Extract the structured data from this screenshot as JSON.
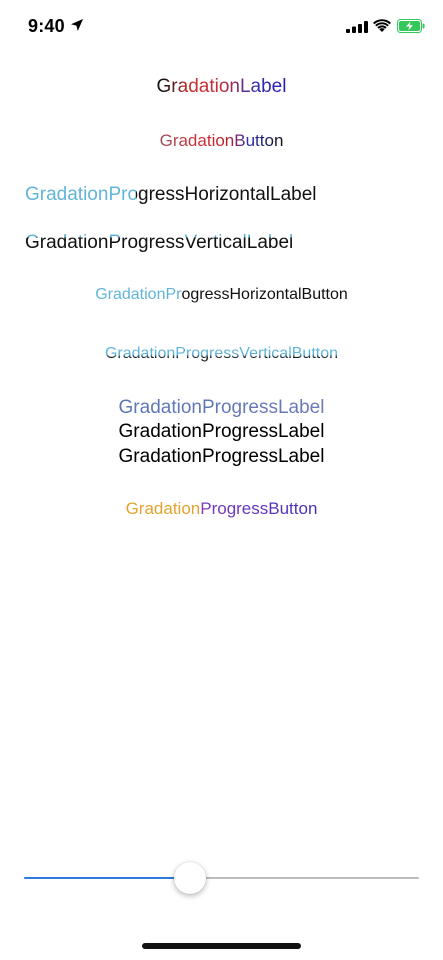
{
  "status_bar": {
    "time": "9:40",
    "icons": [
      "location-arrow-icon",
      "cellular-signal-icon",
      "wifi-icon",
      "battery-charging-icon"
    ],
    "battery_color": "#34c759"
  },
  "labels": {
    "gradation_label": "GradationLabel",
    "gradation_button": "GradationButton",
    "progress_horizontal_label": "GradationProgressHorizontalLabel",
    "progress_vertical_label": "GradationProgressVerticalLabel",
    "progress_horizontal_button": "GradationProgressHorizontalButton",
    "progress_vertical_button": "GradationProgressVerticalButton",
    "progress_labels": [
      "GradationProgressLabel",
      "GradationProgressLabel",
      "GradationProgressLabel"
    ],
    "progress_button": "GradationProgressButton"
  },
  "colors": {
    "progress_light_blue": "#5fb4d9",
    "button_orange": "#e3a12a",
    "button_purple": "#4230b6",
    "label_red": "#c9302c",
    "label_blue": "#2318c0",
    "slider_fill": "#2f7ae0",
    "slider_track": "#bdbdbd"
  },
  "slider": {
    "value": 0.42
  }
}
